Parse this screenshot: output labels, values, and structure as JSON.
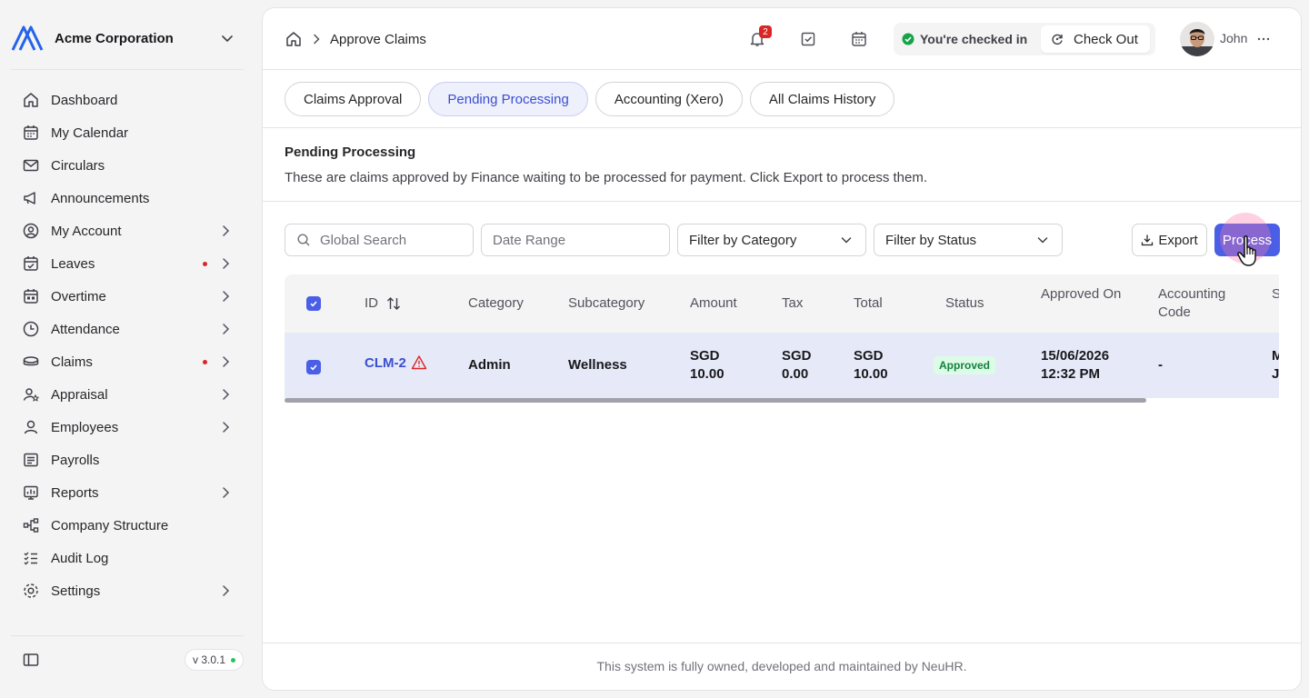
{
  "org": {
    "name": "Acme Corporation"
  },
  "sidebar": {
    "items": [
      {
        "label": "Dashboard",
        "icon": "home-icon",
        "arrow": false,
        "dot": false
      },
      {
        "label": "My Calendar",
        "icon": "calendar-icon",
        "arrow": false,
        "dot": false
      },
      {
        "label": "Circulars",
        "icon": "mail-icon",
        "arrow": false,
        "dot": false
      },
      {
        "label": "Announcements",
        "icon": "megaphone-icon",
        "arrow": false,
        "dot": false
      },
      {
        "label": "My Account",
        "icon": "user-circle-icon",
        "arrow": true,
        "dot": false
      },
      {
        "label": "Leaves",
        "icon": "calendar-check-icon",
        "arrow": true,
        "dot": true
      },
      {
        "label": "Overtime",
        "icon": "calendar-grid-icon",
        "arrow": true,
        "dot": false
      },
      {
        "label": "Attendance",
        "icon": "clock-icon",
        "arrow": true,
        "dot": false
      },
      {
        "label": "Claims",
        "icon": "coins-icon",
        "arrow": true,
        "dot": true
      },
      {
        "label": "Appraisal",
        "icon": "user-star-icon",
        "arrow": true,
        "dot": false
      },
      {
        "label": "Employees",
        "icon": "user-icon",
        "arrow": true,
        "dot": false
      },
      {
        "label": "Payrolls",
        "icon": "receipt-icon",
        "arrow": false,
        "dot": false
      },
      {
        "label": "Reports",
        "icon": "chart-icon",
        "arrow": true,
        "dot": false
      },
      {
        "label": "Company Structure",
        "icon": "hierarchy-icon",
        "arrow": false,
        "dot": false
      },
      {
        "label": "Audit Log",
        "icon": "checklist-icon",
        "arrow": false,
        "dot": false
      },
      {
        "label": "Settings",
        "icon": "gear-icon",
        "arrow": true,
        "dot": false
      }
    ],
    "version": "v 3.0.1"
  },
  "header": {
    "breadcrumb_current": "Approve Claims",
    "notification_count": "2",
    "checkin_status": "You're checked in",
    "checkout_label": "Check Out",
    "user_name": "John"
  },
  "tabs": [
    {
      "label": "Claims Approval",
      "active": false
    },
    {
      "label": "Pending Processing",
      "active": true
    },
    {
      "label": "Accounting (Xero)",
      "active": false
    },
    {
      "label": "All Claims History",
      "active": false
    }
  ],
  "section": {
    "title": "Pending Processing",
    "description": "These are claims approved by Finance waiting to be processed for payment. Click Export to process them."
  },
  "filters": {
    "search_placeholder": "Global Search",
    "date_placeholder": "Date Range",
    "category_label": "Filter by Category",
    "status_label": "Filter by Status",
    "export_label": "Export",
    "process_label": "Process"
  },
  "table": {
    "columns": [
      "ID",
      "Category",
      "Subcategory",
      "Amount",
      "Tax",
      "Total",
      "Status",
      "Approved On",
      "Accounting Code",
      "Submitted By"
    ],
    "rows": [
      {
        "id": "CLM-2",
        "category": "Admin",
        "subcategory": "Wellness",
        "amount": "SGD 10.00",
        "tax": "SGD 0.00",
        "total": "SGD 10.00",
        "status": "Approved",
        "approved_on": "15/06/2026 12:32 PM",
        "accounting_code": "-",
        "submitted_by": "Mark Johnson"
      }
    ]
  },
  "footer": {
    "text": "This system is fully owned, developed and maintained by NeuHR."
  },
  "colors": {
    "accent": "#4a5ee6",
    "danger": "#dc2626",
    "success": "#16a34a"
  }
}
